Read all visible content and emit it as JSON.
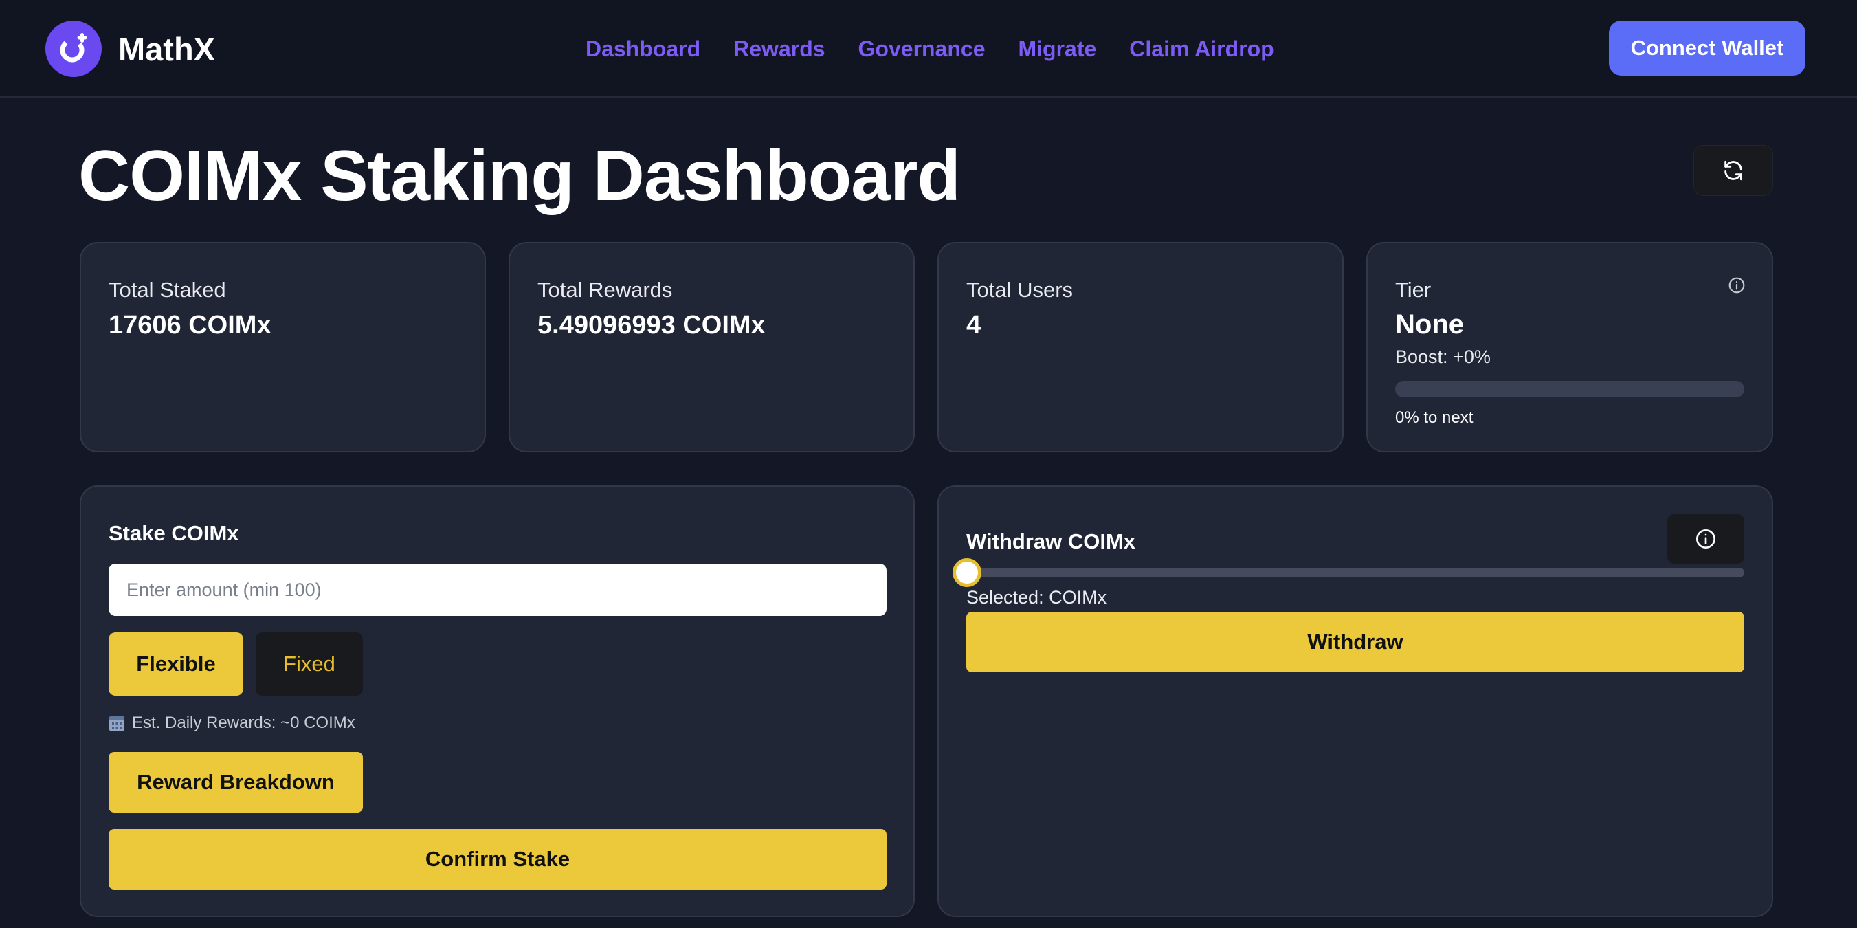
{
  "brand": {
    "name": "MathX",
    "accent": "#6a49f0"
  },
  "nav": {
    "links": [
      "Dashboard",
      "Rewards",
      "Governance",
      "Migrate",
      "Claim Airdrop"
    ],
    "link_color": "#7d5cf6",
    "connect_label": "Connect Wallet"
  },
  "page": {
    "title": "COIMx Staking Dashboard",
    "refresh_icon": "refresh-icon"
  },
  "stats": {
    "total_staked": {
      "label": "Total Staked",
      "value": "17606 COIMx"
    },
    "total_rewards": {
      "label": "Total Rewards",
      "value": "5.49096993 COIMx"
    },
    "total_users": {
      "label": "Total Users",
      "value": "4"
    },
    "tier": {
      "label": "Tier",
      "value": "None",
      "boost": "Boost: +0%",
      "progress_percent": 0,
      "next_text": "0% to next",
      "info_icon": "info-icon"
    }
  },
  "stake": {
    "title": "Stake COIMx",
    "input_placeholder": "Enter amount (min 100)",
    "input_value": "",
    "mode_flexible": "Flexible",
    "mode_fixed": "Fixed",
    "est_icon": "calendar-icon",
    "est_text": "Est. Daily Rewards: ~0 COIMx",
    "breakdown_label": "Reward Breakdown",
    "confirm_label": "Confirm Stake"
  },
  "withdraw": {
    "title": "Withdraw COIMx",
    "info_icon": "info-icon",
    "slider_value": 0,
    "selected_text": "Selected: COIMx",
    "button_label": "Withdraw"
  },
  "colors": {
    "background": "#131726",
    "card": "#212636",
    "yellow": "#ebc93a",
    "primary_button": "#5b6cf7"
  }
}
